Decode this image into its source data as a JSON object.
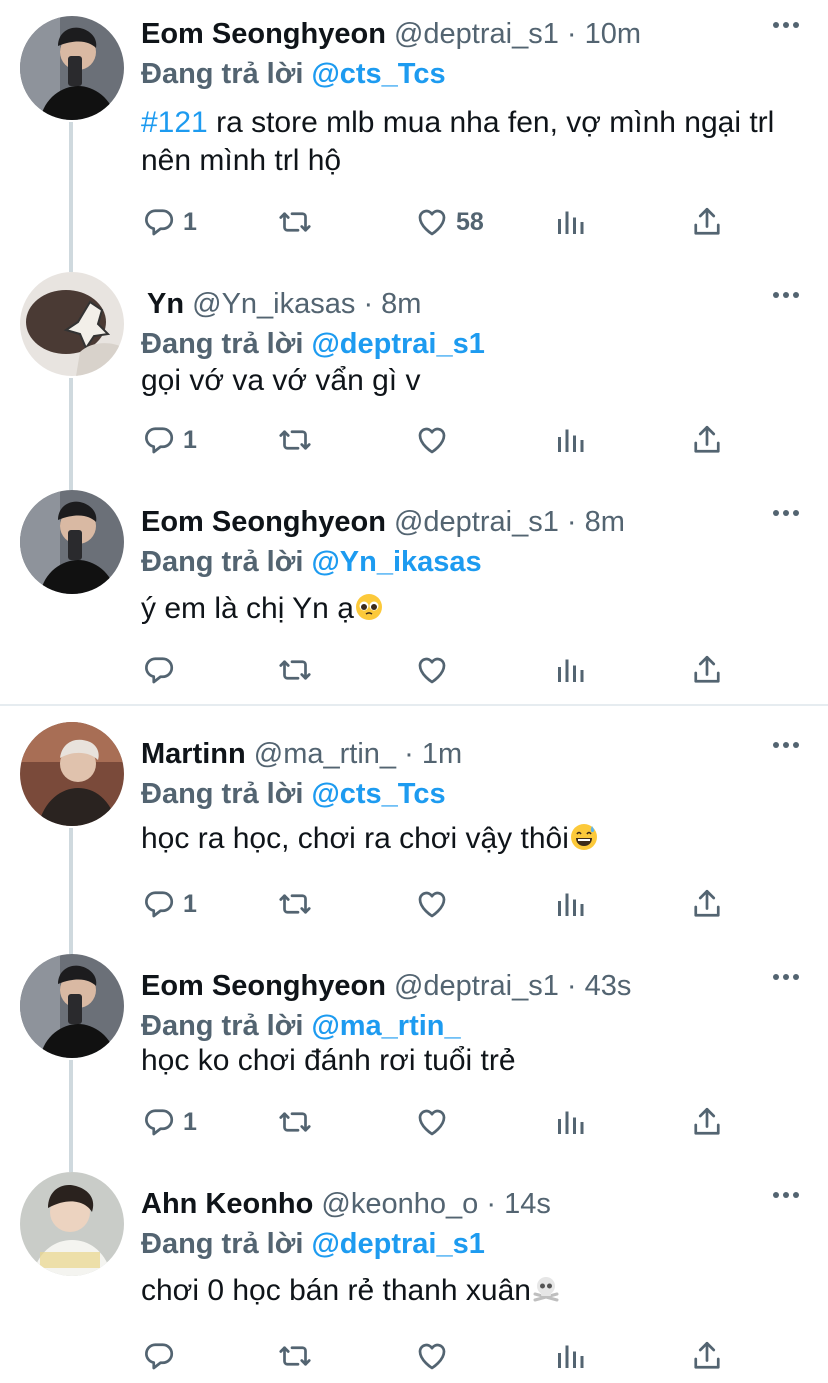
{
  "tweets": [
    {
      "name": "Eom Seonghyeon",
      "handle": "@deptrai_s1",
      "dot": "·",
      "time": "10m",
      "reply_prefix": "Đang trả lời",
      "reply_to": "@cts_Tcs",
      "hashtag": "#121",
      "text": " ra store mlb mua nha fen, vợ mình ngại trl nên mình trl hộ",
      "reply_count": "1",
      "like_count": "58"
    },
    {
      "name": "Yn",
      "handle": "@Yn_ikasas",
      "dot": "·",
      "time": "8m",
      "reply_prefix": "Đang trả lời",
      "reply_to": "@deptrai_s1",
      "text": "gọi vớ va vớ vẩn gì v",
      "reply_count": "1",
      "like_count": ""
    },
    {
      "name": "Eom Seonghyeon",
      "handle": "@deptrai_s1",
      "dot": "·",
      "time": "8m",
      "reply_prefix": "Đang trả lời",
      "reply_to": "@Yn_ikasas",
      "text": "ý em là chị Yn ạ",
      "reply_count": "",
      "like_count": ""
    },
    {
      "name": "Martinn",
      "handle": "@ma_rtin_",
      "dot": "·",
      "time": "1m",
      "reply_prefix": "Đang trả lời",
      "reply_to": "@cts_Tcs",
      "text": "học ra học, chơi ra chơi vậy thôi",
      "reply_count": "1",
      "like_count": ""
    },
    {
      "name": "Eom Seonghyeon",
      "handle": "@deptrai_s1",
      "dot": "·",
      "time": "43s",
      "reply_prefix": "Đang trả lời",
      "reply_to": "@ma_rtin_",
      "text": "học ko chơi đánh rơi tuổi trẻ",
      "reply_count": "1",
      "like_count": ""
    },
    {
      "name": "Ahn Keonho",
      "handle": "@keonho_o",
      "dot": "·",
      "time": "14s",
      "reply_prefix": "Đang trả lời",
      "reply_to": "@deptrai_s1",
      "text": "chơi 0 học bán rẻ thanh xuân",
      "reply_count": "",
      "like_count": ""
    }
  ],
  "icons": {
    "reply": "reply-icon",
    "retweet": "retweet-icon",
    "like": "like-icon",
    "views": "views-icon",
    "share": "share-icon",
    "more": "more-icon"
  },
  "colors": {
    "link": "#1d9bf0",
    "secondary": "#536471",
    "primary": "#0f1419"
  }
}
